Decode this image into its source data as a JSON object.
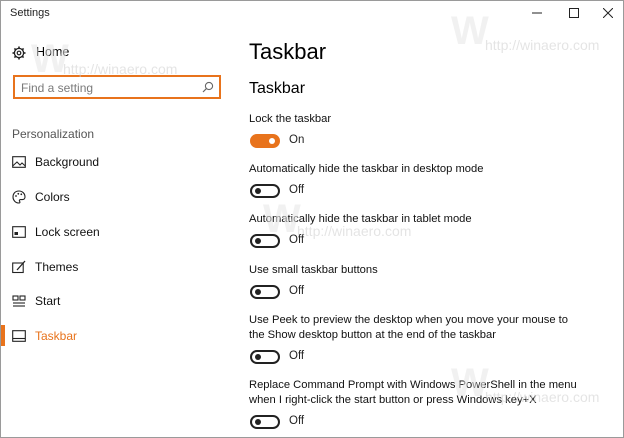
{
  "window": {
    "title": "Settings"
  },
  "sidebar": {
    "home_label": "Home",
    "search_placeholder": "Find a setting",
    "section_label": "Personalization",
    "items": [
      {
        "label": "Background",
        "icon": "background-icon"
      },
      {
        "label": "Colors",
        "icon": "palette-icon"
      },
      {
        "label": "Lock screen",
        "icon": "lock-screen-icon"
      },
      {
        "label": "Themes",
        "icon": "themes-icon"
      },
      {
        "label": "Start",
        "icon": "start-icon"
      },
      {
        "label": "Taskbar",
        "icon": "taskbar-icon",
        "active": true
      }
    ]
  },
  "main": {
    "page_title": "Taskbar",
    "subheader": "Taskbar",
    "settings": [
      {
        "description": "Lock the taskbar",
        "state": "On",
        "on": true
      },
      {
        "description": "Automatically hide the taskbar in desktop mode",
        "state": "Off",
        "on": false
      },
      {
        "description": "Automatically hide the taskbar in tablet mode",
        "state": "Off",
        "on": false
      },
      {
        "description": "Use small taskbar buttons",
        "state": "Off",
        "on": false
      },
      {
        "description": "Use Peek to preview the desktop when you move your mouse to the Show desktop button at the end of the taskbar",
        "state": "Off",
        "on": false
      },
      {
        "description": "Replace Command Prompt with Windows PowerShell in the menu when I right-click the start button or press Windows key+X",
        "state": "Off",
        "on": false
      }
    ]
  },
  "watermark": "http://winaero.com",
  "colors": {
    "accent": "#e8731c"
  }
}
